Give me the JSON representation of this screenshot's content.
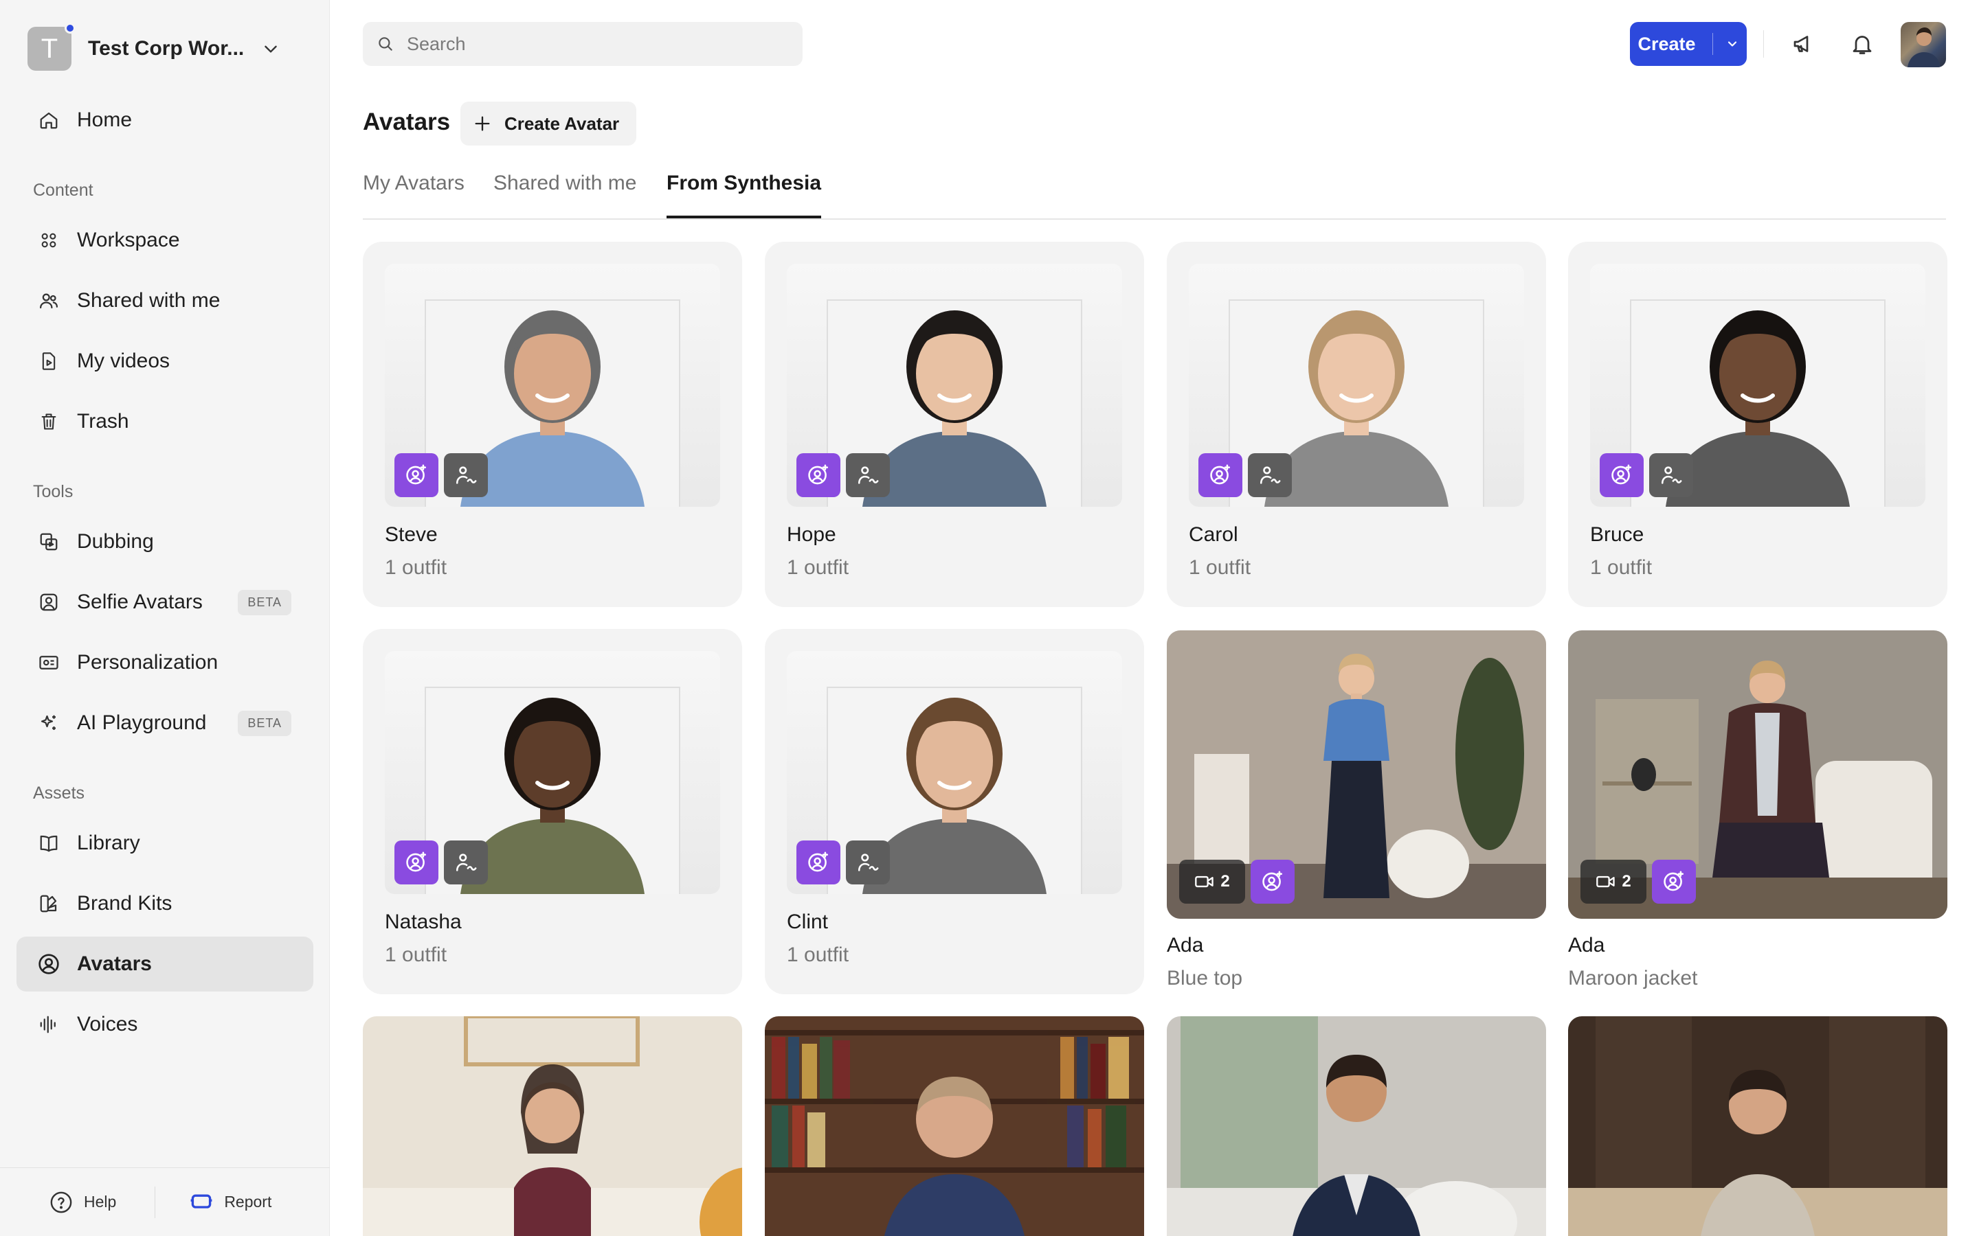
{
  "workspace": {
    "initial": "T",
    "name": "Test Corp Wor..."
  },
  "nav": {
    "home": "Home",
    "content_label": "Content",
    "workspace": "Workspace",
    "shared": "Shared with me",
    "my_videos": "My videos",
    "trash": "Trash",
    "tools_label": "Tools",
    "dubbing": "Dubbing",
    "selfie": "Selfie Avatars",
    "selfie_badge": "BETA",
    "personalization": "Personalization",
    "ai_playground": "AI Playground",
    "ai_badge": "BETA",
    "assets_label": "Assets",
    "library": "Library",
    "brand_kits": "Brand Kits",
    "avatars": "Avatars",
    "voices": "Voices"
  },
  "footer": {
    "help": "Help",
    "report": "Report"
  },
  "search": {
    "placeholder": "Search"
  },
  "topbar": {
    "create": "Create"
  },
  "page": {
    "title": "Avatars",
    "create_avatar": "Create Avatar",
    "tabs": [
      "My Avatars",
      "Shared with me",
      "From Synthesia"
    ],
    "active_tab": "From Synthesia"
  },
  "avatars": [
    {
      "name": "Steve",
      "outfits": "1 outfit",
      "skin": "#d9a888",
      "hair": "#6b6b6b",
      "shirt": "#7fa2cf"
    },
    {
      "name": "Hope",
      "outfits": "1 outfit",
      "skin": "#e8c1a3",
      "hair": "#1e1a18",
      "shirt": "#5c6f86"
    },
    {
      "name": "Carol",
      "outfits": "1 outfit",
      "skin": "#ecc6aa",
      "hair": "#b9976f",
      "shirt": "#8a8a8a"
    },
    {
      "name": "Bruce",
      "outfits": "1 outfit",
      "skin": "#6e4a34",
      "hair": "#161210",
      "shirt": "#5a5a5a"
    },
    {
      "name": "Natasha",
      "outfits": "1 outfit",
      "skin": "#5d3d2a",
      "hair": "#1b1410",
      "shirt": "#6d7350"
    },
    {
      "name": "Clint",
      "outfits": "1 outfit",
      "skin": "#e2b89a",
      "hair": "#6a4a30",
      "shirt": "#6b6b6b"
    }
  ],
  "scenes": [
    {
      "name": "Ada",
      "caption": "Blue top",
      "count": "2"
    },
    {
      "name": "Ada",
      "caption": "Maroon jacket",
      "count": "2"
    }
  ],
  "colors": {
    "accent": "#2d49dc",
    "badge_purple": "#8a4be0",
    "badge_gray": "#5d5d5d"
  }
}
